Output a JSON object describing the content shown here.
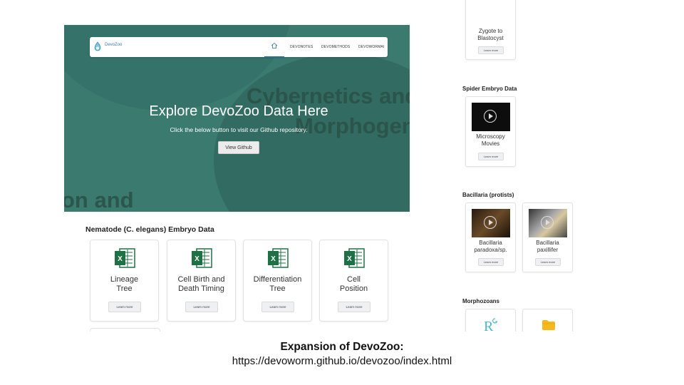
{
  "site": {
    "navbar": {
      "logo_text": "DevoZoo",
      "links": [
        "DEVONOTES",
        "DEVOMETHODS",
        "DEVOWORMAI"
      ]
    },
    "hero": {
      "bg_text": [
        "Cybernetics and",
        "Morphogen",
        "on and"
      ],
      "title": "Explore DevoZoo Data Here",
      "subtitle": "Click the below button to visit our Github repository.",
      "button_label": "View Github"
    },
    "nematode": {
      "title": "Nematode (C. elegans) Embryo Data",
      "cards": [
        {
          "label": "Lineage\nTree",
          "button": "Learn more",
          "icon": "excel-icon"
        },
        {
          "label": "Cell Birth and\nDeath Timing",
          "button": "Learn more",
          "icon": "excel-icon"
        },
        {
          "label": "Differentiation\nTree",
          "button": "Learn more",
          "icon": "excel-icon"
        },
        {
          "label": "Cell\nPosition",
          "button": "Learn more",
          "icon": "excel-icon"
        }
      ]
    }
  },
  "right": {
    "top_card": {
      "label": "Zygote to\nBlastocyst",
      "button": "Learn more"
    },
    "spider": {
      "title": "Spider Embryo Data",
      "cards": [
        {
          "label": "Microscopy\nMovies",
          "button": "Learn more",
          "icon": "video-icon"
        }
      ]
    },
    "bacillaria": {
      "title": "Bacillaria (protists)",
      "cards": [
        {
          "label": "Bacillaria\nparadoxa/sp.",
          "button": "Learn more",
          "icon": "video-icon"
        },
        {
          "label": "Bacillaria\npaxillifer",
          "button": "Learn more",
          "icon": "video-icon"
        }
      ]
    },
    "morphozoans": {
      "title": "Morphozoans",
      "cards": [
        {
          "icon": "r-graphics-icon",
          "text": "R"
        },
        {
          "icon": "folder-icon"
        }
      ]
    }
  },
  "caption": {
    "title": "Expansion of DevoZoo:",
    "url": "https://devoworm.github.io/devozoo/index.html"
  },
  "colors": {
    "hero": "#3a7a6f",
    "excel": "#1e7145",
    "folder": "#f5b91e",
    "r_logo": "#4ab7c5"
  }
}
